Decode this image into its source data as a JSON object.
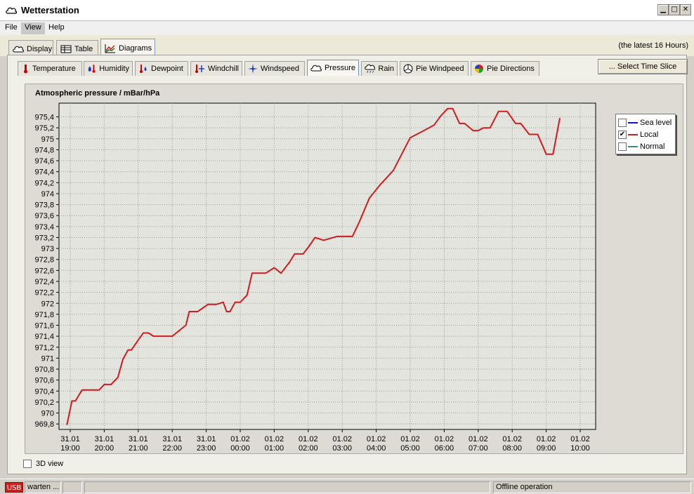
{
  "window": {
    "title": "Wetterstation"
  },
  "menu": {
    "items": [
      "File",
      "View",
      "Help"
    ]
  },
  "top_tabs": [
    "Display",
    "Table",
    "Diagrams"
  ],
  "time_hint": "(the latest 16 Hours)",
  "sub_tabs": [
    "Temperature",
    "Humidity",
    "Dewpoint",
    "Windchill",
    "Windspeed",
    "Pressure",
    "Rain",
    "Pie Windpeed",
    "Pie Directions"
  ],
  "select_time_slice": "... Select Time Slice",
  "legend": {
    "items": [
      {
        "label": "Sea level",
        "checked": false,
        "color": "#1010d0"
      },
      {
        "label": "Local",
        "checked": true,
        "color": "#d01c1c"
      },
      {
        "label": "Normal",
        "checked": false,
        "color": "#3a8a8a"
      }
    ],
    "check_mark": "✔"
  },
  "three_d_view": {
    "label": "3D view",
    "checked": false
  },
  "status": {
    "usb": "USB",
    "state": "warten ...",
    "mode": "Offline operation"
  },
  "chart_data": {
    "type": "line",
    "title": "Atmospheric pressure / mBar/hPa",
    "ylim": [
      969.7,
      975.65
    ],
    "y_ticks": [
      "969,8",
      "970",
      "970,2",
      "970,4",
      "970,6",
      "970,8",
      "971",
      "971,2",
      "971,4",
      "971,6",
      "971,8",
      "972",
      "972,2",
      "972,4",
      "972,6",
      "972,8",
      "973",
      "973,2",
      "973,4",
      "973,6",
      "973,8",
      "974",
      "974,2",
      "974,4",
      "974,6",
      "974,8",
      "975",
      "975,2",
      "975,4"
    ],
    "x_ticks": [
      [
        "31.01",
        "19:00"
      ],
      [
        "31.01",
        "20:00"
      ],
      [
        "31.01",
        "21:00"
      ],
      [
        "31.01",
        "22:00"
      ],
      [
        "31.01",
        "23:00"
      ],
      [
        "01.02",
        "00:00"
      ],
      [
        "01.02",
        "01:00"
      ],
      [
        "01.02",
        "02:00"
      ],
      [
        "01.02",
        "03:00"
      ],
      [
        "01.02",
        "04:00"
      ],
      [
        "01.02",
        "05:00"
      ],
      [
        "01.02",
        "06:00"
      ],
      [
        "01.02",
        "07:00"
      ],
      [
        "01.02",
        "08:00"
      ],
      [
        "01.02",
        "09:00"
      ],
      [
        "01.02",
        "10:00"
      ]
    ],
    "grid": true,
    "legend_position": "top-right",
    "series": [
      {
        "name": "Local",
        "color": "#d01c1c",
        "x_hours": [
          -0.1,
          0.05,
          0.15,
          0.35,
          0.55,
          0.85,
          1.0,
          1.2,
          1.4,
          1.55,
          1.7,
          1.8,
          2.0,
          2.15,
          2.3,
          2.45,
          3.0,
          3.4,
          3.5,
          3.6,
          3.75,
          4.05,
          4.3,
          4.5,
          4.6,
          4.7,
          4.85,
          5.0,
          5.2,
          5.35,
          5.6,
          5.75,
          6.0,
          6.2,
          6.45,
          6.6,
          6.85,
          7.0,
          7.2,
          7.45,
          7.85,
          8.0,
          8.3,
          8.5,
          8.8,
          9.1,
          9.5,
          9.75,
          10.0,
          10.4,
          10.7,
          10.9,
          11.1,
          11.25,
          11.45,
          11.6,
          11.85,
          12.0,
          12.15,
          12.35,
          12.6,
          12.85,
          13.1,
          13.25,
          13.5,
          13.75,
          14.0,
          14.2,
          14.4,
          14.6,
          14.75,
          14.95,
          15.1,
          15.3,
          15.45,
          15.6,
          15.7
        ],
        "values": [
          969.78,
          970.22,
          970.22,
          970.42,
          970.42,
          970.42,
          970.52,
          970.52,
          970.65,
          970.98,
          971.15,
          971.15,
          971.33,
          971.46,
          971.46,
          971.4,
          971.4,
          971.6,
          971.85,
          971.85,
          971.85,
          971.98,
          971.98,
          972.02,
          971.85,
          971.85,
          972.02,
          972.02,
          972.15,
          972.55,
          972.55,
          972.55,
          972.65,
          972.55,
          972.75,
          972.9,
          972.9,
          973.02,
          973.2,
          973.15,
          973.22,
          973.22,
          973.22,
          973.48,
          973.92,
          974.15,
          974.42,
          974.72,
          975.02,
          975.15,
          975.25,
          975.42,
          975.55,
          975.55,
          975.28,
          975.28,
          975.15,
          975.15,
          975.2,
          975.2,
          975.5,
          975.5,
          975.28,
          975.28,
          975.08,
          975.08,
          974.72,
          974.72,
          975.38
        ]
      }
    ]
  }
}
